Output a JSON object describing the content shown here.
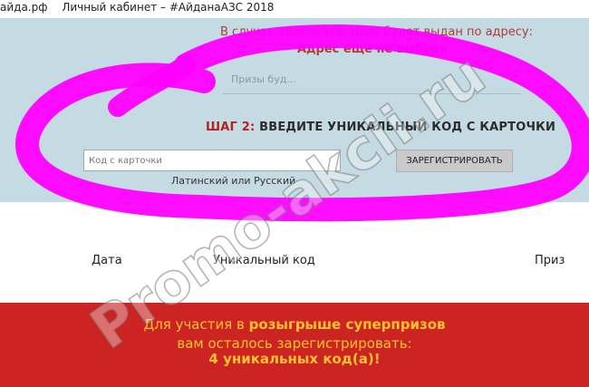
{
  "browser_tabs": {
    "domain": "айда.рф",
    "title": "Личный кабинет – #АйданаАЗС 2018"
  },
  "address": {
    "line1": "В случае выигрыша, приз будет выдан по адресу:",
    "line2": "Адрес еще не выбран",
    "prize_hint": "Призы буд..."
  },
  "step": {
    "number": "ШАГ 2:",
    "text": "ВВЕДИТЕ УНИКАЛЬНЫЙ КОД С КАРТОЧКИ"
  },
  "form": {
    "code_placeholder": "Код с карточки",
    "register_label": "ЗАРЕГИСТРИРОВАТЬ",
    "hint": "Латинский или Русский"
  },
  "table": {
    "headers": [
      "Дата",
      "Уникальный код",
      "Приз"
    ]
  },
  "banner": {
    "line1_prefix": "Для участия в",
    "line1_bold": "розыгрыше суперпризов",
    "line2": "вам осталось зарегистрировать:",
    "line3": "4 уникальных код(а)!"
  },
  "watermark": "Promo-akcii.ru",
  "colors": {
    "panel_bg": "#c5dbe3",
    "accent_red": "#b22222",
    "banner_bg": "#cc2323",
    "banner_text": "#ffc42b",
    "brush": "#ff00ff"
  }
}
